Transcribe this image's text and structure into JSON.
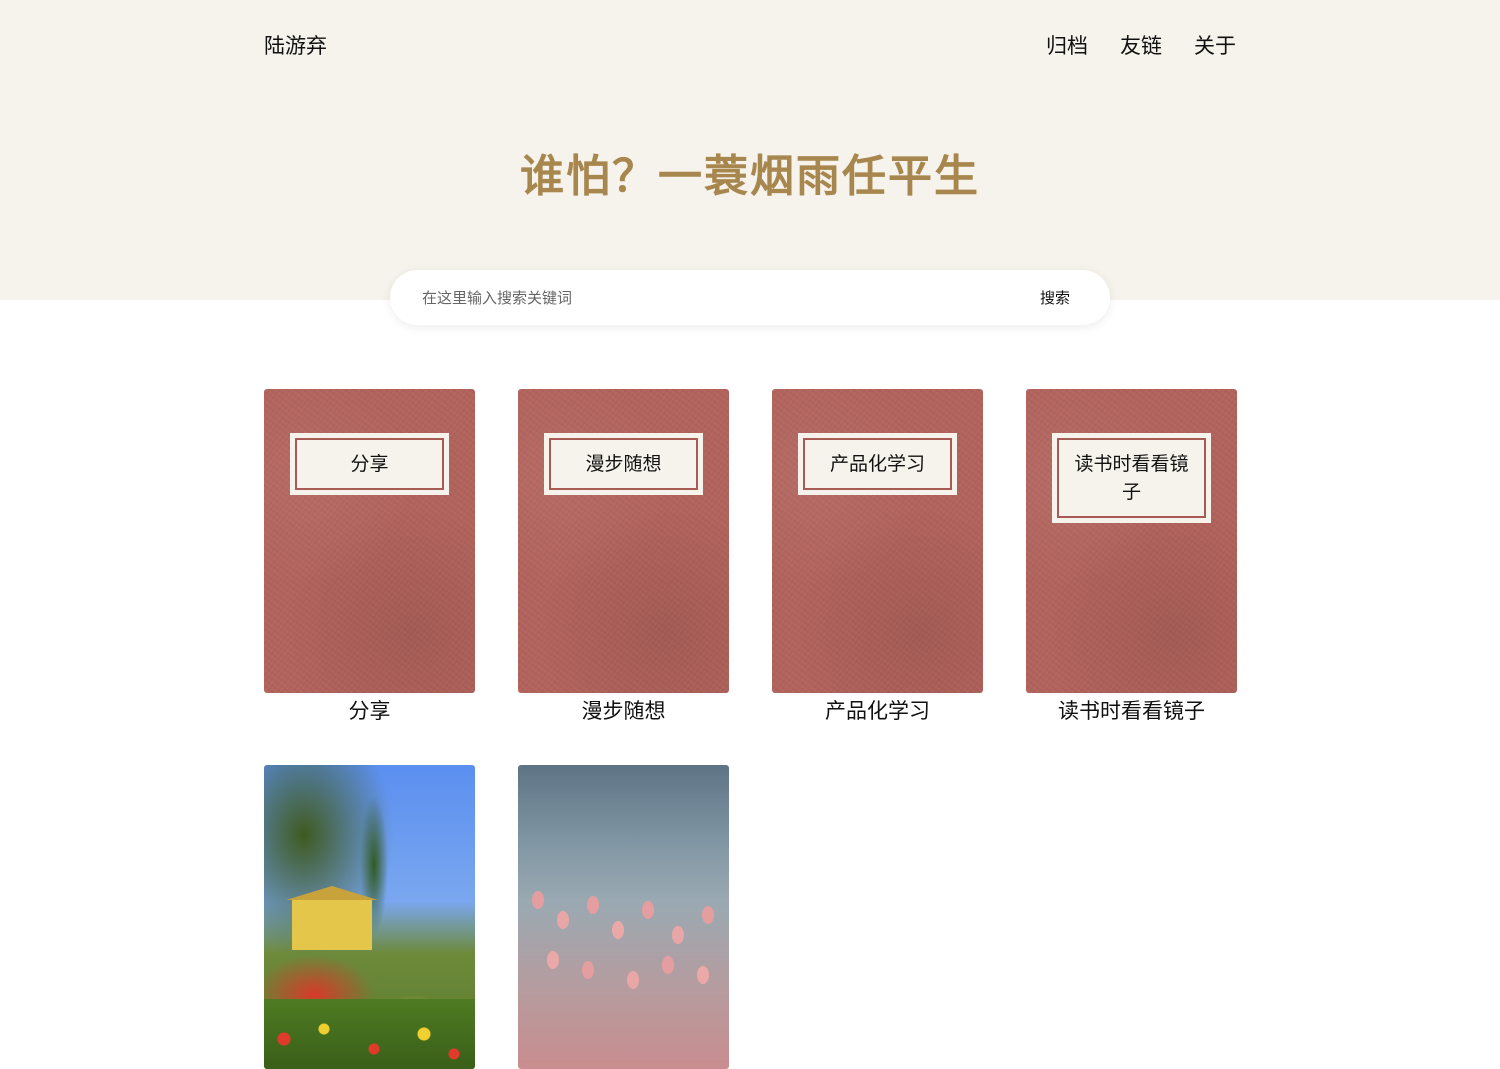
{
  "header": {
    "site_title": "陆游弃",
    "nav": [
      {
        "label": "归档"
      },
      {
        "label": "友链"
      },
      {
        "label": "关于"
      }
    ]
  },
  "hero": {
    "slogan": "谁怕？一蓑烟雨任平生"
  },
  "search": {
    "placeholder": "在这里输入搜索关键词",
    "button_label": "搜索"
  },
  "categories": [
    {
      "cover_label": "分享",
      "caption": "分享"
    },
    {
      "cover_label": "漫步随想",
      "caption": "漫步随想"
    },
    {
      "cover_label": "产品化学习",
      "caption": "产品化学习"
    },
    {
      "cover_label": "读书时看看镜子",
      "caption": "读书时看看镜子"
    }
  ],
  "image_cards": [
    {
      "image": "garden-painting"
    },
    {
      "image": "flamingos-photo"
    }
  ],
  "colors": {
    "hero_bg": "#f6f3ec",
    "slogan": "#a8874f",
    "book_cover": "#b2635c",
    "label_border": "#a85a54"
  }
}
